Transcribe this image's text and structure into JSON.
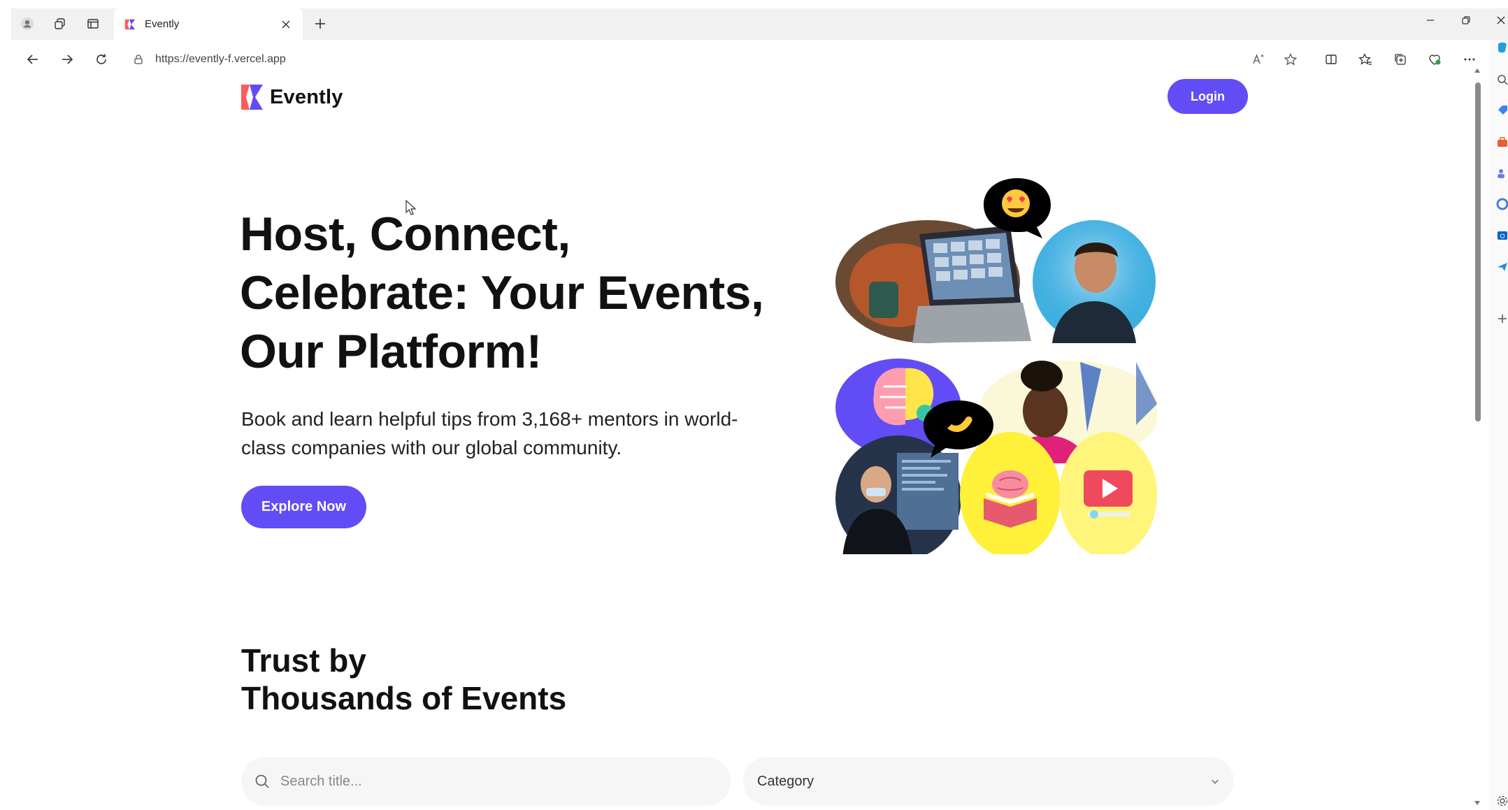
{
  "browser": {
    "tab_title": "Evently",
    "url": "https://evently-f.vercel.app"
  },
  "header": {
    "brand": "Evently",
    "login_label": "Login"
  },
  "hero": {
    "title": "Host, Connect, Celebrate: Your Events, Our Platform!",
    "subtitle": "Book and learn helpful tips from 3,168+ mentors in world-class companies with our global community.",
    "cta_label": "Explore Now"
  },
  "events_section": {
    "title_line1": "Trust by",
    "title_line2": "Thousands of Events",
    "search_placeholder": "Search title...",
    "category_label": "Category"
  },
  "colors": {
    "accent": "#624cf5",
    "logo_top": "#ff5b5b",
    "logo_bottom": "#624cf5",
    "yellow": "#fff03a",
    "light_yellow": "#fff57a",
    "purple": "#624cf5"
  },
  "icons": {
    "chrome": [
      "profile-icon",
      "workspaces-icon",
      "tab-actions-icon",
      "new-tab-icon",
      "back-icon",
      "forward-icon",
      "refresh-icon",
      "lock-icon",
      "read-aloud-icon",
      "favorite-icon",
      "split-screen-icon",
      "favorites-icon",
      "collections-icon",
      "browser-essentials-icon",
      "more-icon"
    ],
    "page": [
      "search-icon",
      "chevron-down-icon"
    ]
  }
}
